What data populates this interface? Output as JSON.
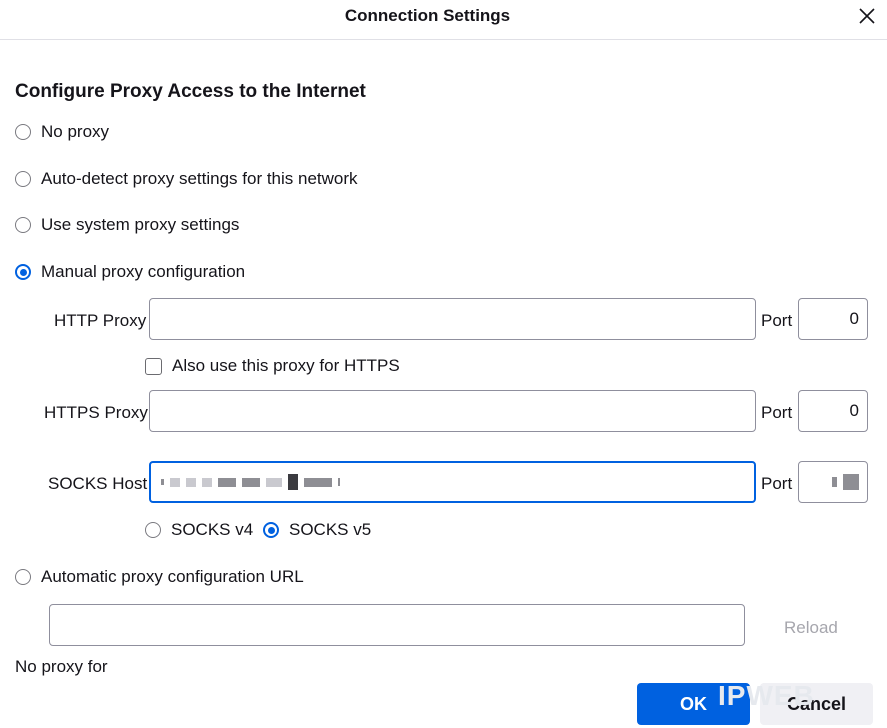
{
  "window": {
    "title": "Connection Settings"
  },
  "heading": "Configure Proxy Access to the Internet",
  "proxy_options": [
    {
      "label": "No proxy",
      "selected": false
    },
    {
      "label": "Auto-detect proxy settings for this network",
      "selected": false
    },
    {
      "label": "Use system proxy settings",
      "selected": false
    },
    {
      "label": "Manual proxy configuration",
      "selected": true
    }
  ],
  "manual": {
    "http_proxy_label": "HTTP Proxy",
    "http_proxy_value": "",
    "http_port_label": "Port",
    "http_port_value": "0",
    "also_https_label": "Also use this proxy for HTTPS",
    "also_https_checked": false,
    "https_proxy_label": "HTTPS Proxy",
    "https_proxy_value": "",
    "https_port_label": "Port",
    "https_port_value": "0",
    "socks_host_label": "SOCKS Host",
    "socks_port_label": "Port",
    "socks_v4_label": "SOCKS v4",
    "socks_v5_label": "SOCKS v5",
    "socks_version_selected": "SOCKS v5"
  },
  "auto_config": {
    "label": "Automatic proxy configuration URL",
    "url_value": "",
    "reload_label": "Reload"
  },
  "no_proxy_for_label": "No proxy for",
  "buttons": {
    "ok": "OK",
    "cancel": "Cancel"
  },
  "watermark": "IPWEB",
  "colors": {
    "accent": "#0061e0",
    "border": "#8f8f9d",
    "text": "#15141a"
  }
}
